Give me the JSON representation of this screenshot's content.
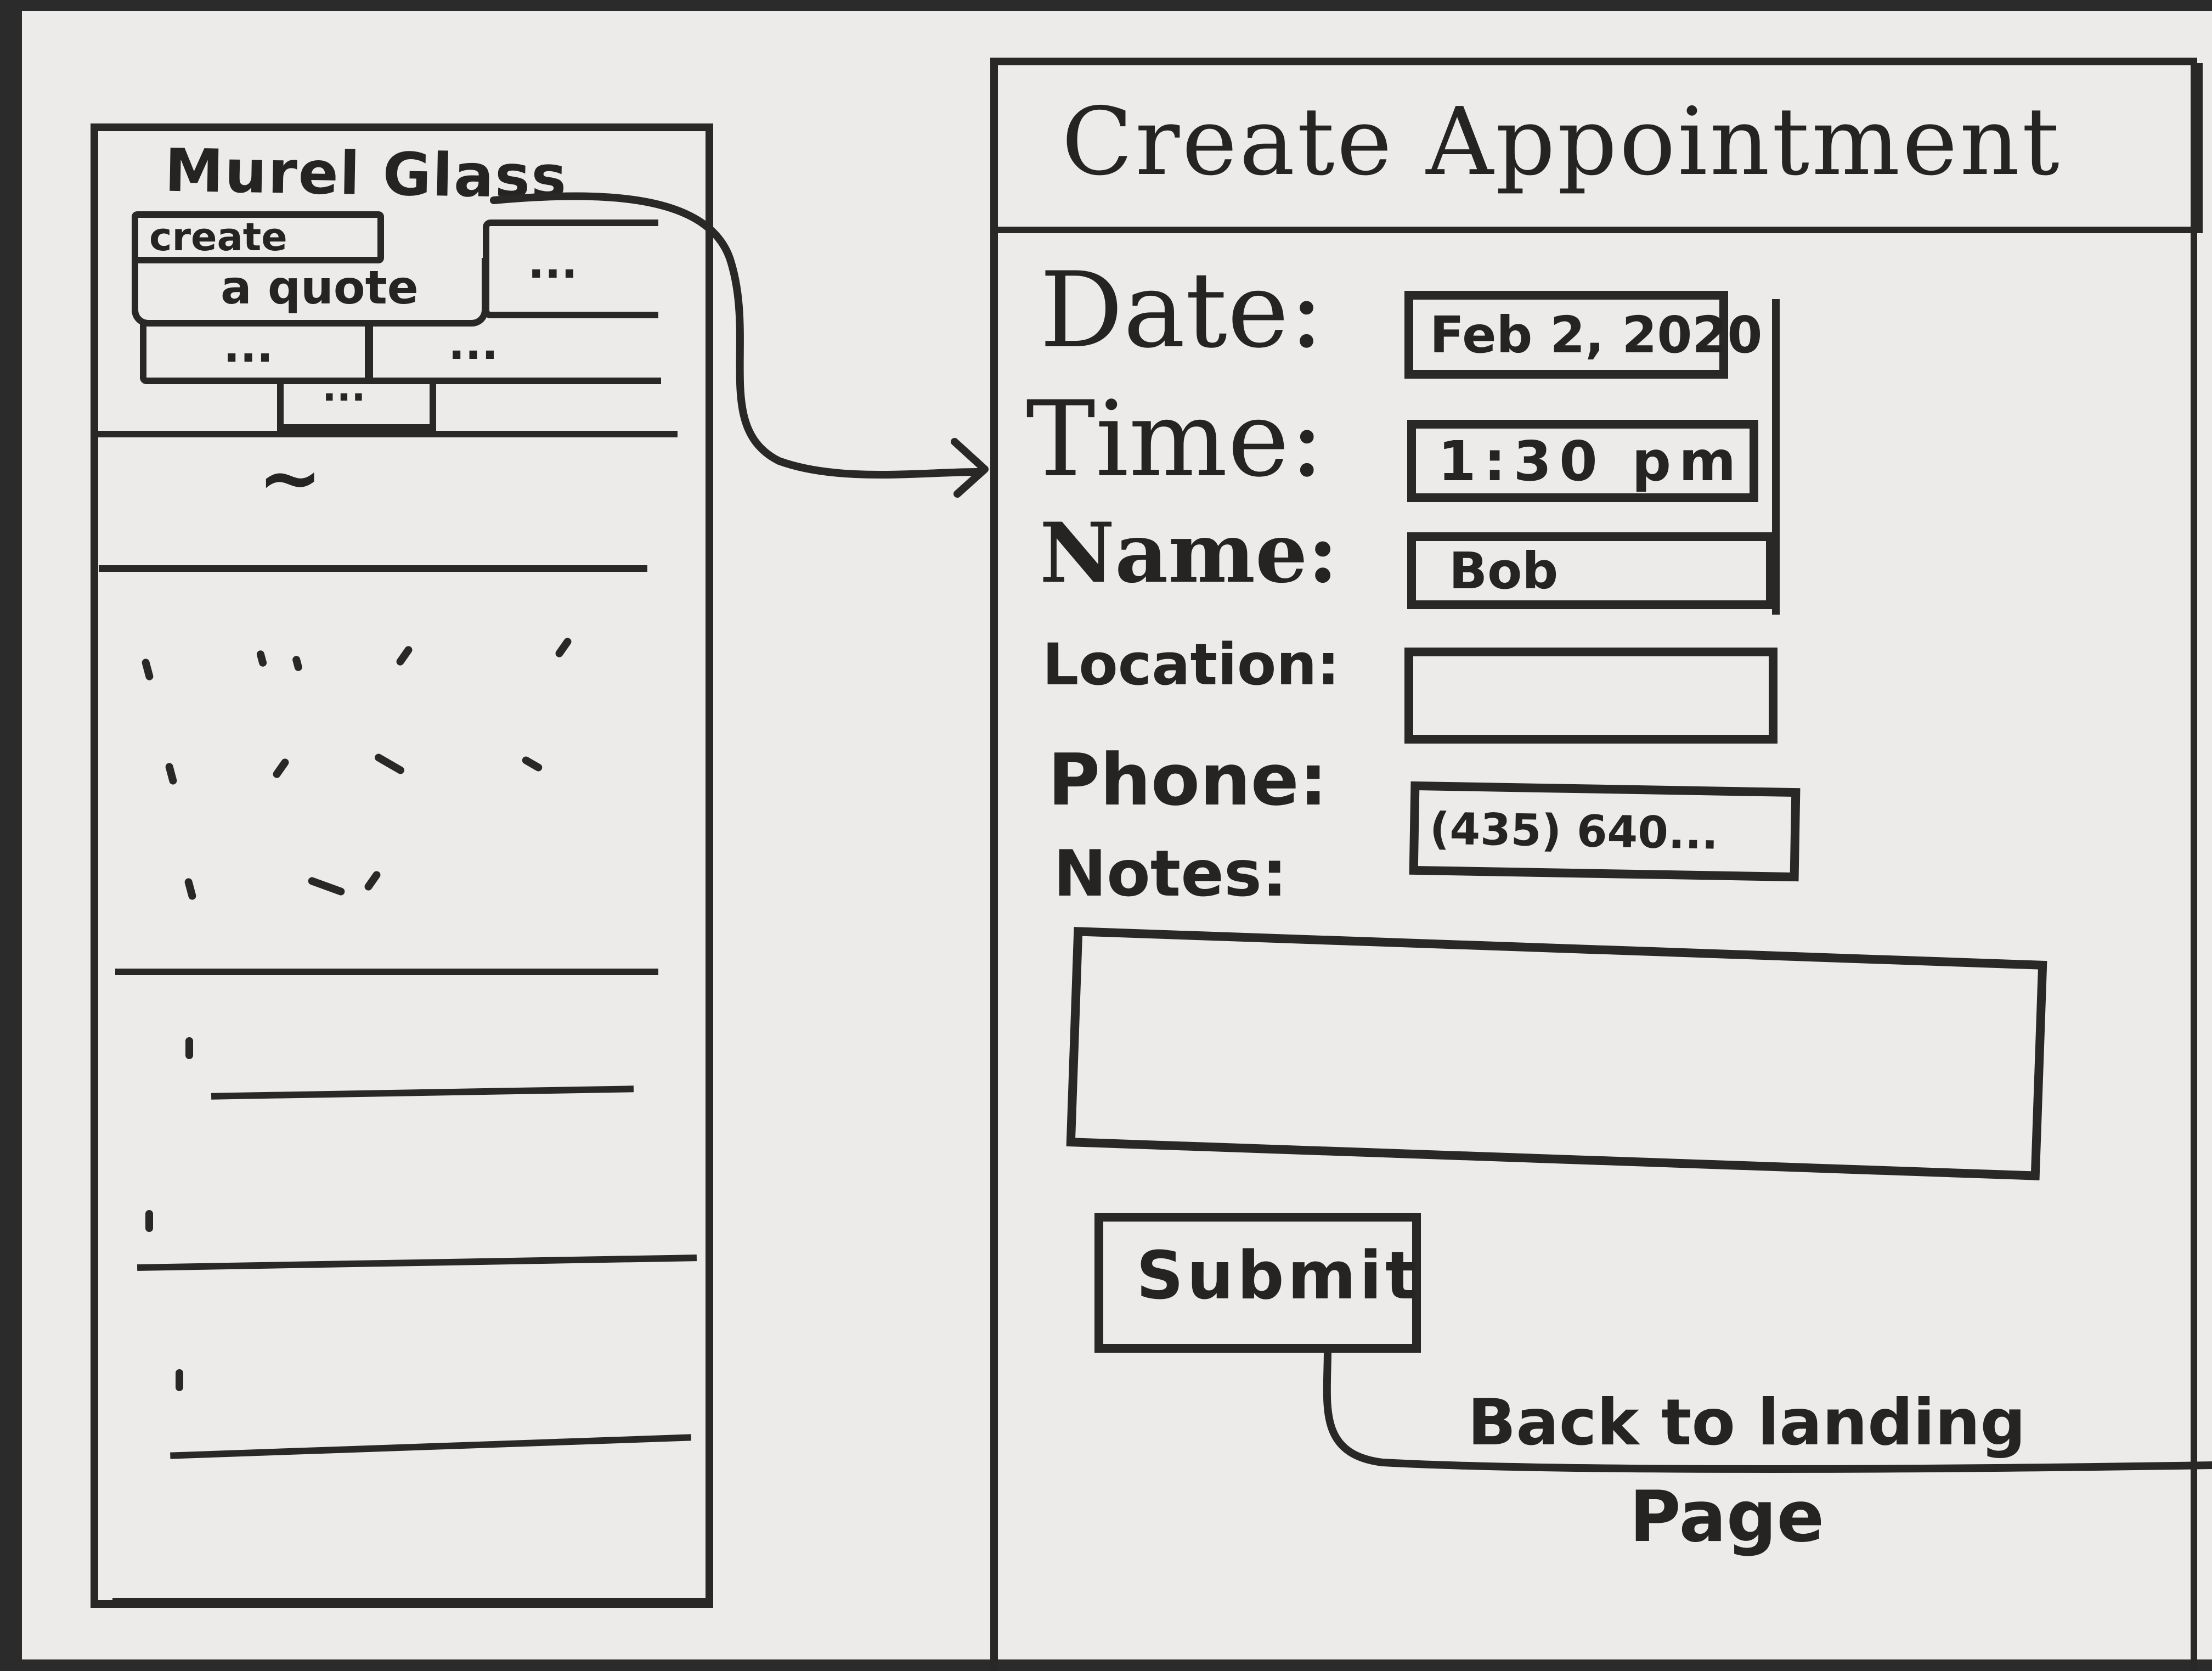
{
  "landing": {
    "title": "Murel Glass",
    "quote_button_top": "create",
    "quote_button_bottom": "a quote",
    "button_placeholder_1": "...",
    "button_placeholder_2": "...",
    "button_placeholder_3": "...",
    "button_placeholder_4": "...",
    "section_scribble": "~",
    "list_marks": [
      "1",
      "1"
    ]
  },
  "form": {
    "title": "Create Appointment",
    "fields": {
      "date": {
        "label": "Date:",
        "value": "Feb 2, 2020"
      },
      "time": {
        "label": "Time:",
        "value": "1:30 pm"
      },
      "name": {
        "label": "Name:",
        "value": "Bob"
      },
      "location": {
        "label": "Location:",
        "value": ""
      },
      "phone": {
        "label": "Phone:",
        "value": "(435) 640..."
      },
      "notes": {
        "label": "Notes:",
        "value": ""
      }
    },
    "submit_label": "Submit",
    "submit_annotation_line1": "Back to landing",
    "submit_annotation_line2": "Page"
  }
}
